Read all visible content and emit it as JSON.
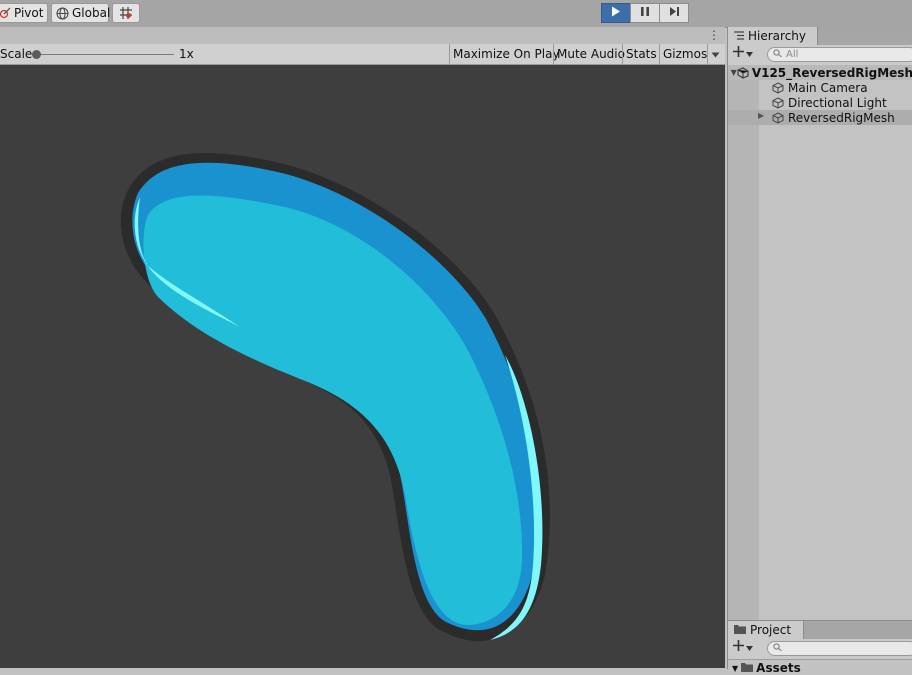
{
  "toolbar": {
    "pivot_label": "Pivot",
    "global_label": "Global",
    "icons": [
      "pivot-icon",
      "globe-icon",
      "snap-grid-icon"
    ],
    "play_state": "playing",
    "accent_color": "#3c6ea8"
  },
  "game_view": {
    "scale_label": "Scale",
    "scale_value": "1x",
    "buttons": [
      "Maximize On Play",
      "Mute Audio",
      "Stats",
      "Gizmos"
    ],
    "background_color": "#3e3e3e",
    "mesh_colors": {
      "outline": "#2b2b2b",
      "dark": "#1a92cf",
      "light": "#22bdd8",
      "rim": "#7ff7fb"
    }
  },
  "hierarchy": {
    "tab_label": "Hierarchy",
    "search_placeholder": "All",
    "scene_name": "V125_ReversedRigMesh",
    "items": [
      {
        "label": "Main Camera"
      },
      {
        "label": "Directional Light"
      },
      {
        "label": "ReversedRigMesh"
      }
    ]
  },
  "project": {
    "tab_label": "Project",
    "assets_label": "Assets"
  }
}
